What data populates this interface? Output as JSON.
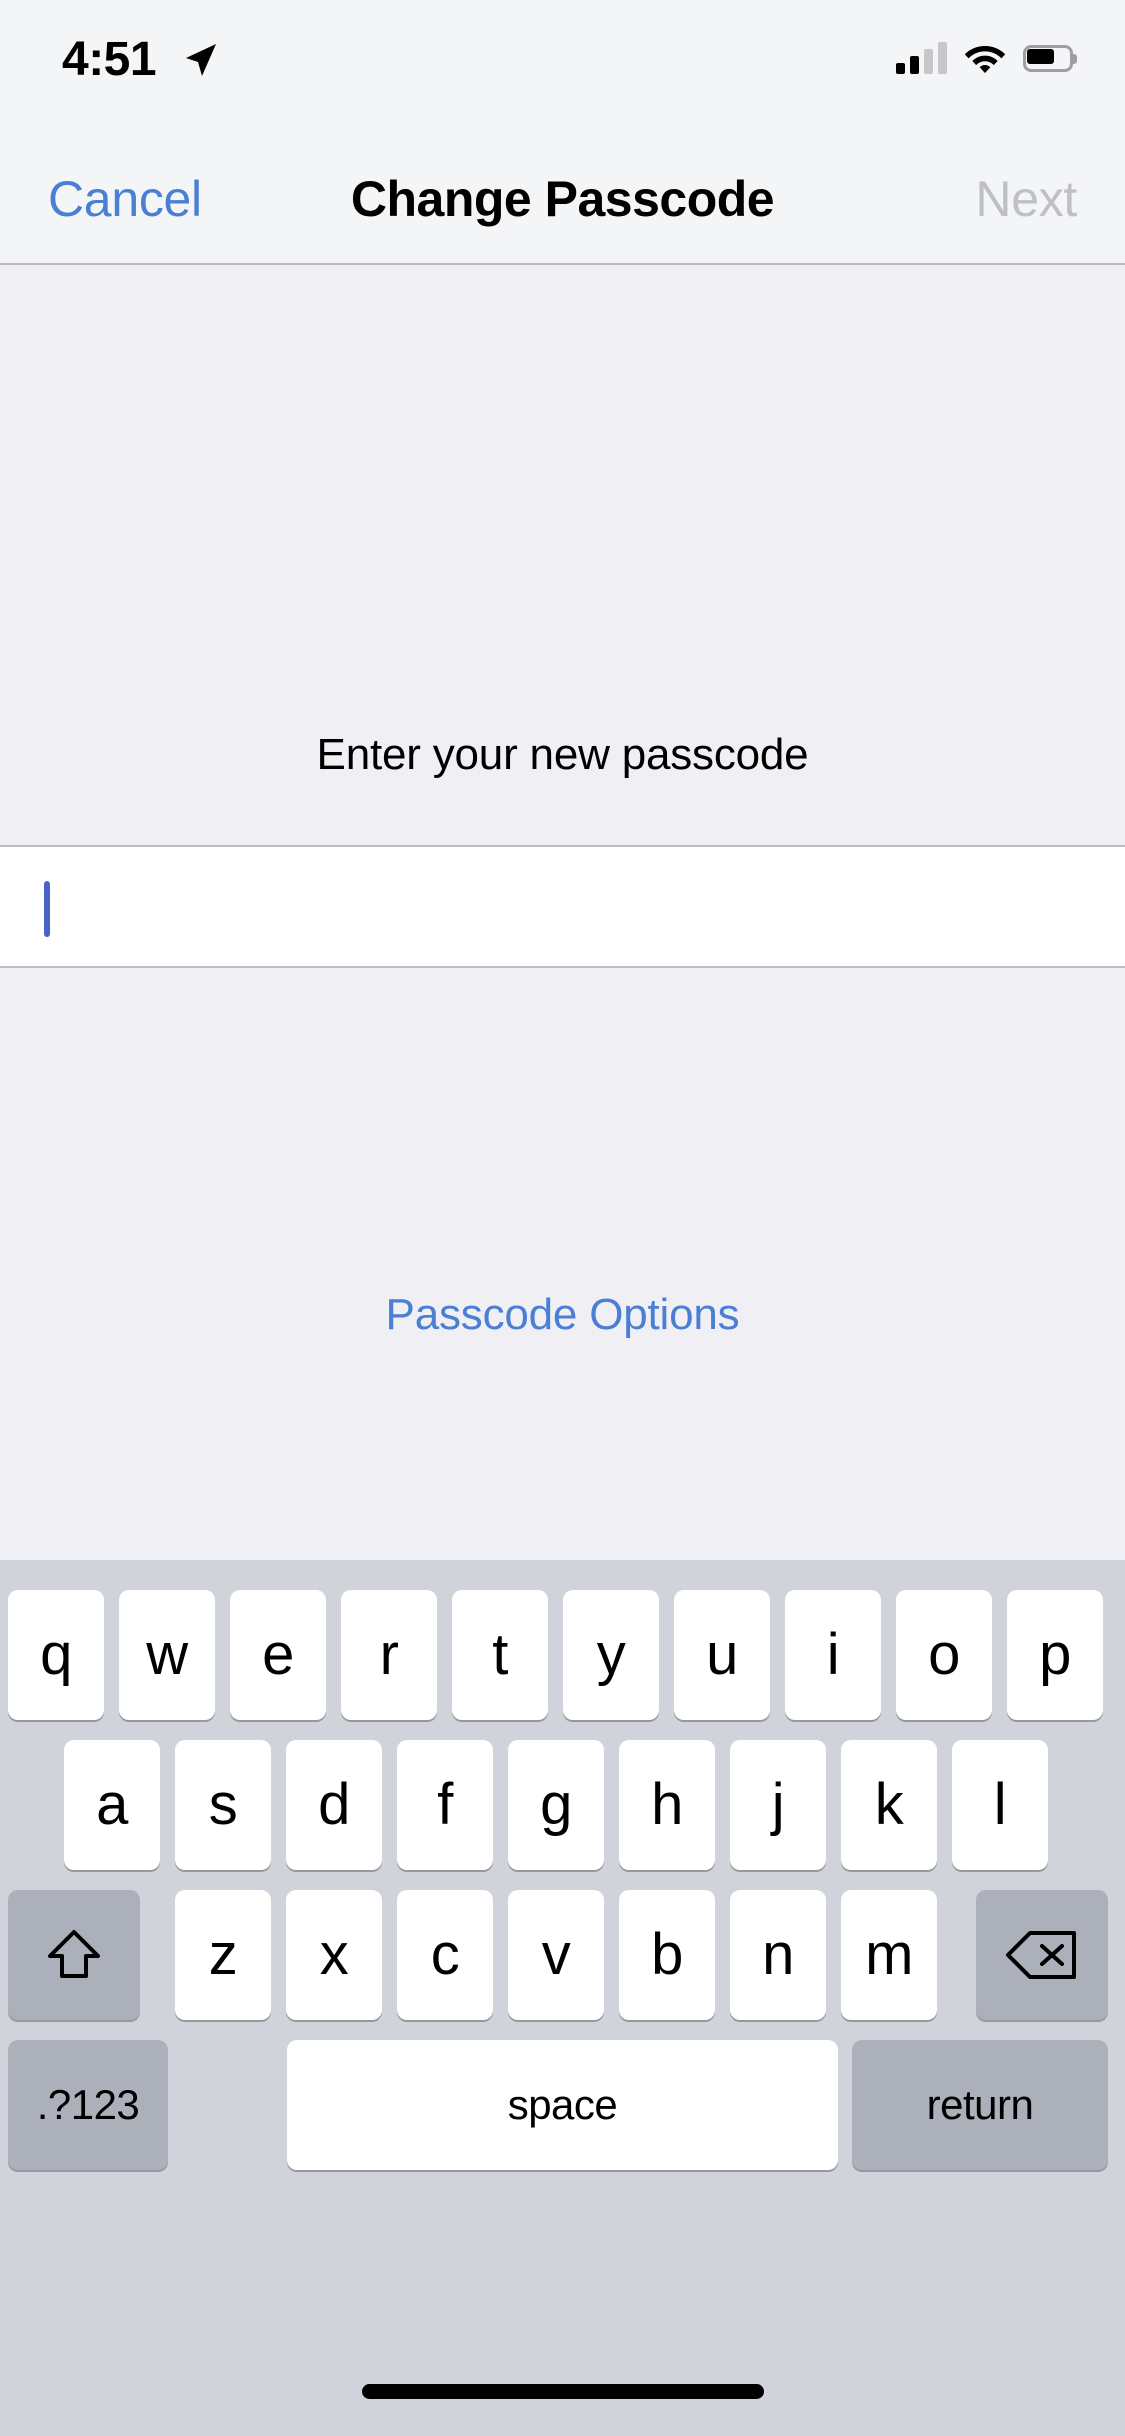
{
  "status_bar": {
    "time": "4:51",
    "location_icon": "location-arrow-icon",
    "signal_icon": "cellular-signal-icon",
    "signal_bars_filled": 2,
    "signal_bars_total": 4,
    "wifi_icon": "wifi-icon",
    "battery_icon": "battery-icon",
    "battery_level_percent": 60
  },
  "nav_bar": {
    "cancel_label": "Cancel",
    "title": "Change Passcode",
    "next_label": "Next",
    "next_enabled": false,
    "cancel_color": "#4A7FD4",
    "next_color": "#BFC0C4"
  },
  "content": {
    "prompt": "Enter your new passcode",
    "passcode_value": "",
    "passcode_options_label": "Passcode Options",
    "link_color": "#4A7FD4",
    "caret_color": "#4A63C8",
    "background_color": "#EFEFF4",
    "field_background_color": "#FFFFFF"
  },
  "keyboard": {
    "background_color": "#D0D3DA",
    "key_color": "#FFFFFF",
    "special_key_color": "#ACB0BA",
    "row1": [
      "q",
      "w",
      "e",
      "r",
      "t",
      "y",
      "u",
      "i",
      "o",
      "p"
    ],
    "row2": [
      "a",
      "s",
      "d",
      "f",
      "g",
      "h",
      "j",
      "k",
      "l"
    ],
    "row3": [
      "z",
      "x",
      "c",
      "v",
      "b",
      "n",
      "m"
    ],
    "shift_icon": "shift-arrow-icon",
    "delete_icon": "backspace-delete-icon",
    "numbers_label": ".?123",
    "space_label": "space",
    "return_label": "return"
  },
  "home_indicator": {
    "label": "home-indicator"
  }
}
